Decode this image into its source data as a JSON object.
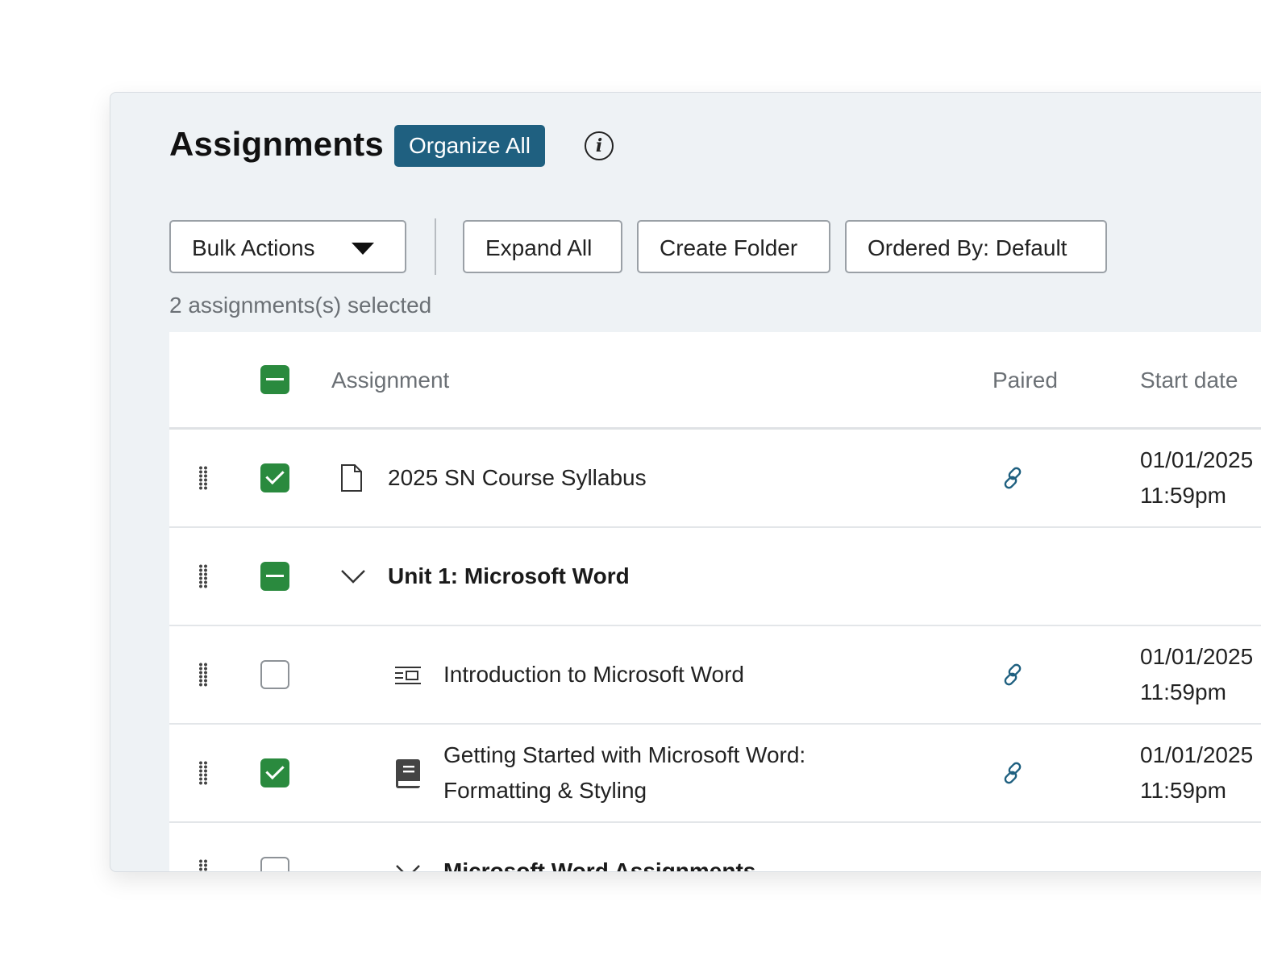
{
  "header": {
    "title": "Assignments",
    "organize_label": "Organize All",
    "info_glyph": "i"
  },
  "toolbar": {
    "bulk_label": "Bulk Actions",
    "expand_label": "Expand All",
    "create_folder_label": "Create Folder",
    "ordered_label": "Ordered By: Default"
  },
  "selected_count": "2 assignments(s) selected",
  "table": {
    "columns": {
      "assignment": "Assignment",
      "paired": "Paired",
      "start_date": "Start date"
    },
    "rows": [
      {
        "title": "2025 SN Course Syllabus",
        "icon": "document-icon",
        "checked": "checked",
        "paired": "link-icon",
        "date": "01/01/2025",
        "time": "11:59pm"
      },
      {
        "title": "Unit 1: Microsoft Word",
        "icon": "chevron-down-icon",
        "checked": "partial"
      },
      {
        "title": "Introduction to Microsoft Word",
        "icon": "lesson-icon",
        "checked": "unchecked",
        "paired": "link-icon",
        "date": "01/01/2025",
        "time": "11:59pm"
      },
      {
        "title_line1": "Getting Started with Microsoft Word:",
        "title_line2": "Formatting & Styling",
        "icon": "book-icon",
        "checked": "checked",
        "paired": "link-icon",
        "date": "01/01/2025",
        "time": "11:59pm"
      },
      {
        "title": "Microsoft Word Assignments",
        "icon": "chevron-down-icon",
        "checked": "unchecked"
      }
    ]
  },
  "colors": {
    "accent": "#1f6080",
    "checkbox_green": "#2a8a3e",
    "link_blue": "#1f6080",
    "panel_bg": "#eef2f5"
  }
}
